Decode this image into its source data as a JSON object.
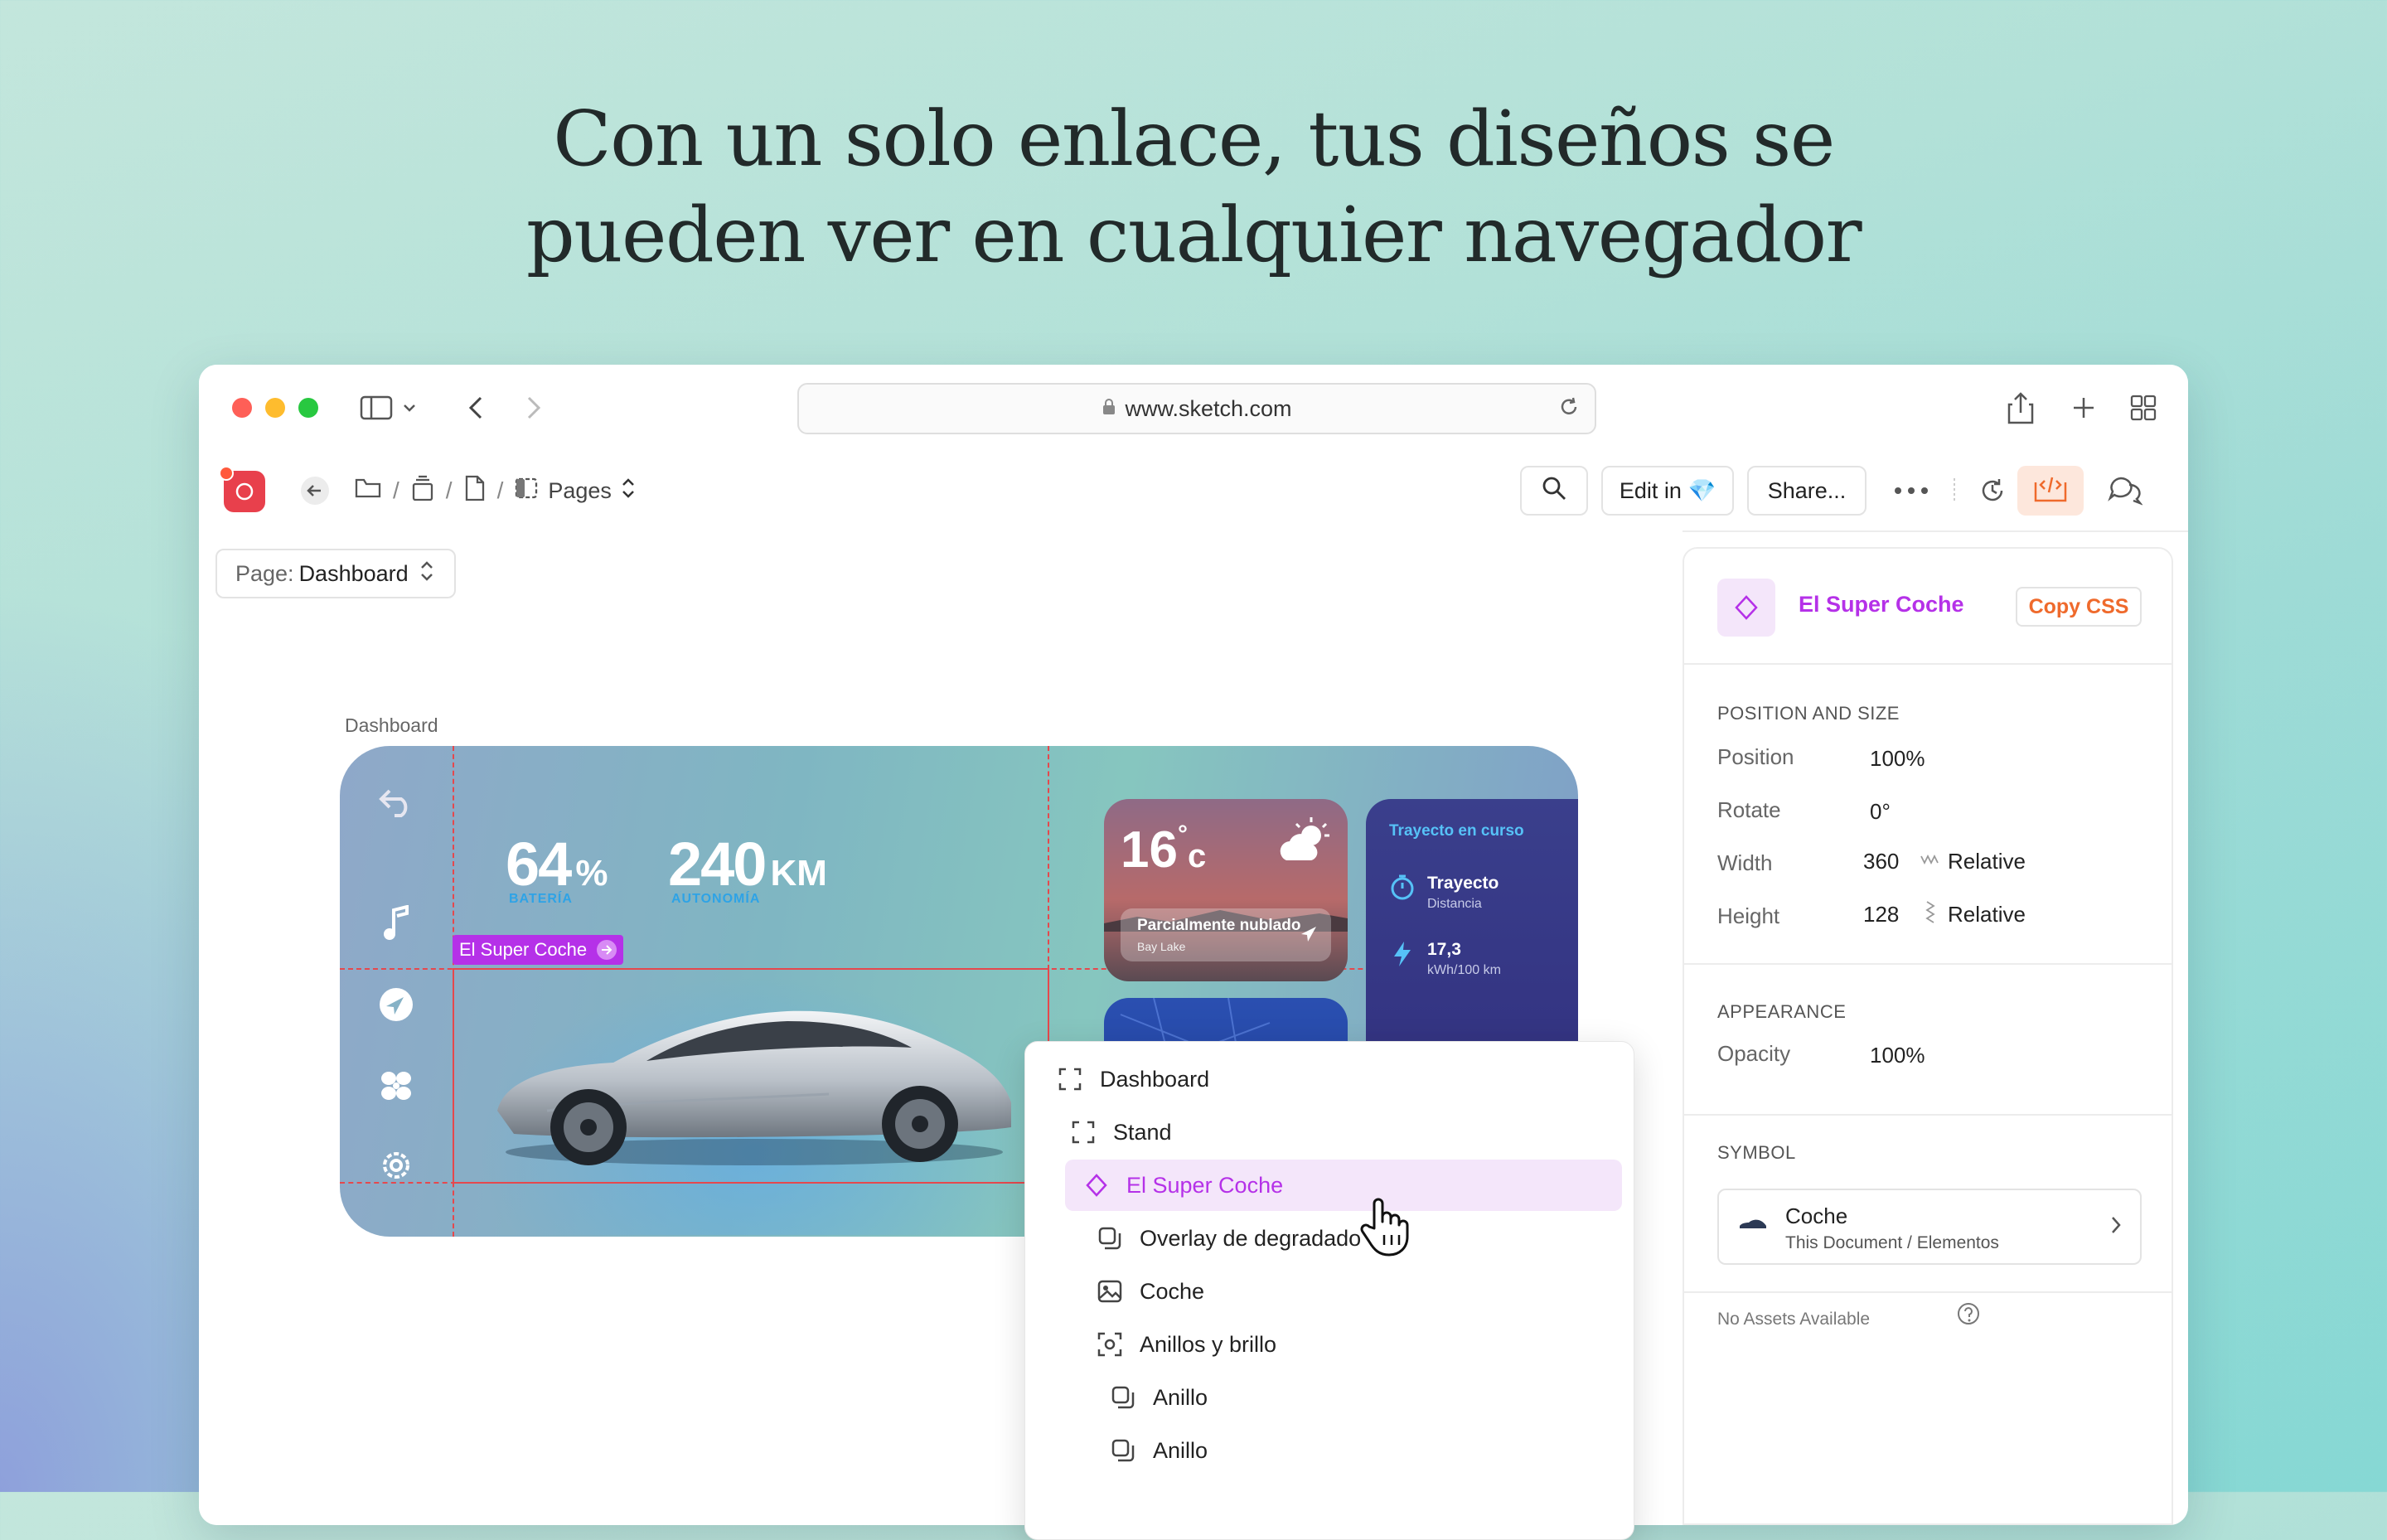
{
  "headline": {
    "line1": "Con un solo enlace, tus diseños se",
    "line2": "pueden ver en cualquier navegador"
  },
  "browser": {
    "url": "www.sketch.com"
  },
  "toolbar": {
    "pages_label": "Pages",
    "edit_in_label": "Edit in 💎",
    "share_label": "Share..."
  },
  "canvas": {
    "page_label": "Page:",
    "page_value": "Dashboard",
    "artboard_label": "Dashboard"
  },
  "dashboard": {
    "battery_value": "64",
    "battery_unit": "%",
    "battery_label": "BATERÍA",
    "range_value": "240",
    "range_unit": "KM",
    "range_label": "AUTONOMÍA",
    "selection_tag": "El Super Coche",
    "weather": {
      "temp": "16",
      "deg": "°",
      "unit": "c",
      "condition": "Parcialmente nublado",
      "location": "Bay Lake"
    },
    "trip": {
      "title": "Trayecto en curso",
      "row1_main": "Trayecto",
      "row1_sub": "Distancia",
      "row2_main": "17,3",
      "row2_sub": "kWh/100 km"
    }
  },
  "layers": [
    {
      "label": "Dashboard",
      "icon": "artboard-icon"
    },
    {
      "label": "Stand",
      "icon": "artboard-icon"
    },
    {
      "label": "El Super Coche",
      "icon": "symbol-icon",
      "selected": true
    },
    {
      "label": "Overlay de degradado",
      "icon": "group-icon"
    },
    {
      "label": "Coche",
      "icon": "image-icon"
    },
    {
      "label": "Anillos y brillo",
      "icon": "group-icon"
    },
    {
      "label": "Anillo",
      "icon": "layer-icon"
    },
    {
      "label": "Anillo",
      "icon": "layer-icon"
    }
  ],
  "inspector": {
    "title": "El Super Coche",
    "copy_css": "Copy CSS",
    "position_size_title": "POSITION AND SIZE",
    "position_label": "Position",
    "position_value": "100%",
    "rotate_label": "Rotate",
    "rotate_value": "0°",
    "width_label": "Width",
    "width_value": "360",
    "width_mode": "Relative",
    "height_label": "Height",
    "height_value": "128",
    "height_mode": "Relative",
    "appearance_title": "APPEARANCE",
    "opacity_label": "Opacity",
    "opacity_value": "100%",
    "symbol_title": "SYMBOL",
    "symbol_name": "Coche",
    "symbol_path": "This Document / Elementos",
    "no_assets": "No Assets Available"
  },
  "colors": {
    "accent_purple": "#b531e8",
    "accent_orange": "#ef6a2c",
    "selection_red": "#e5484d"
  }
}
